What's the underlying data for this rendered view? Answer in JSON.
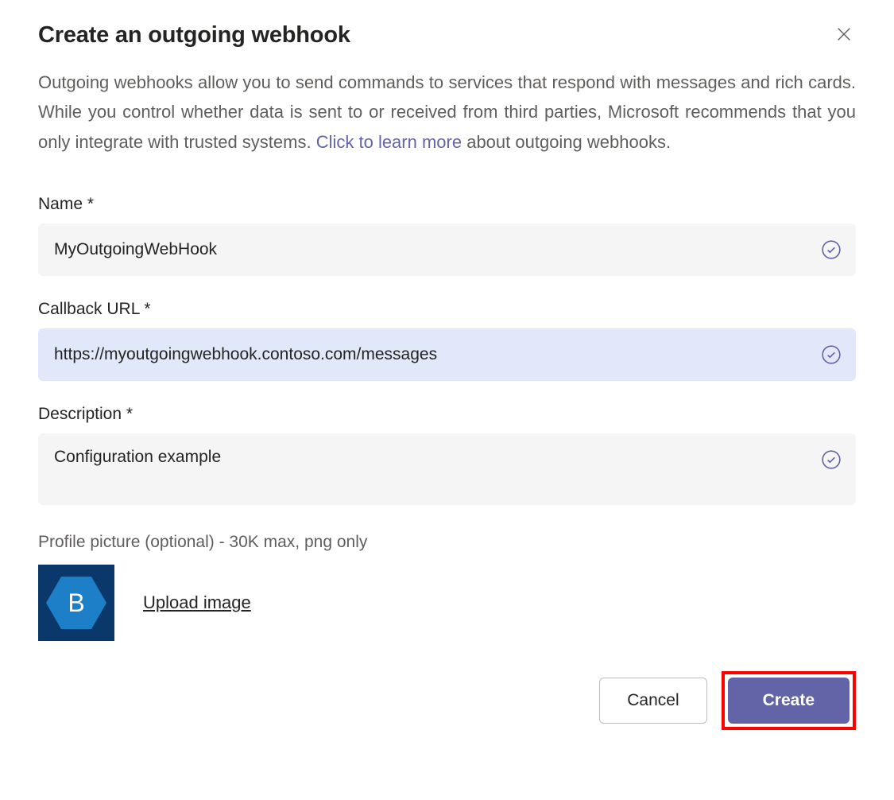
{
  "dialog": {
    "title": "Create an outgoing webhook",
    "description_pre": "Outgoing webhooks allow you to send commands to services that respond with messages and rich cards. While you control whether data is sent to or received from third parties, Microsoft recommends that you only integrate with trusted systems. ",
    "description_link": "Click to learn more",
    "description_post": " about outgoing webhooks."
  },
  "form": {
    "name": {
      "label": "Name *",
      "value": "MyOutgoingWebHook"
    },
    "callback": {
      "label": "Callback URL *",
      "value": "https://myoutgoingwebhook.contoso.com/messages"
    },
    "desc": {
      "label": "Description *",
      "value": "Configuration example"
    },
    "profile": {
      "label": "Profile picture (optional) - 30K max, png only",
      "avatar_letter": "B",
      "upload_label": "Upload image"
    }
  },
  "footer": {
    "cancel": "Cancel",
    "create": "Create"
  }
}
